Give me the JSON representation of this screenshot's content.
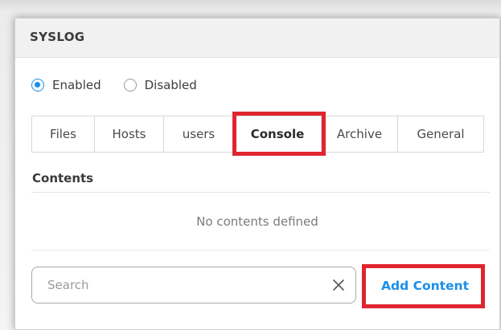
{
  "panel": {
    "title": "SYSLOG"
  },
  "status": {
    "options": [
      {
        "label": "Enabled",
        "checked": true
      },
      {
        "label": "Disabled",
        "checked": false
      }
    ]
  },
  "tabs": [
    {
      "label": "Files",
      "active": false
    },
    {
      "label": "Hosts",
      "active": false
    },
    {
      "label": "users",
      "active": false
    },
    {
      "label": "Console",
      "active": true
    },
    {
      "label": "Archive",
      "active": false
    },
    {
      "label": "General",
      "active": false
    }
  ],
  "contents": {
    "heading": "Contents",
    "empty_message": "No contents defined"
  },
  "search": {
    "placeholder": "Search",
    "value": ""
  },
  "actions": {
    "add_content_label": "Add Content"
  },
  "colors": {
    "accent": "#1a8ee8",
    "highlight": "#e0252f",
    "header_bg": "#f1f1f1"
  },
  "icons": {
    "clear": "close-icon"
  }
}
